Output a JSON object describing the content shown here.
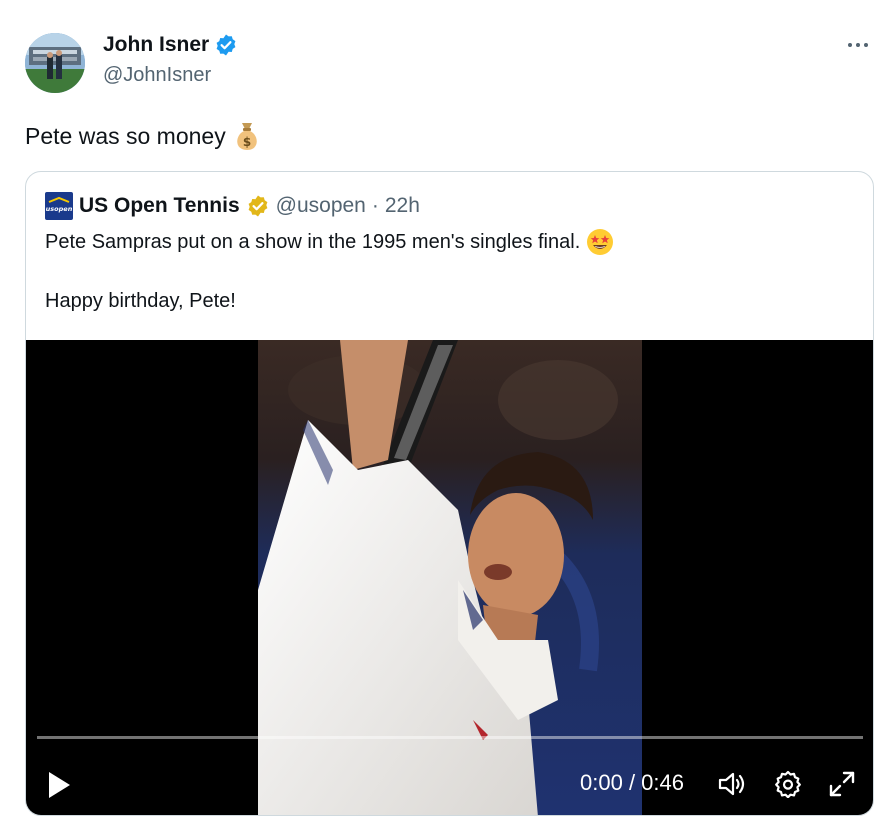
{
  "tweet": {
    "author_name": "John Isner",
    "author_handle": "@JohnIsner",
    "text": "Pete was so money",
    "emoji_icon": "money-bag-icon"
  },
  "quote": {
    "logo_text": "usopen",
    "author_name": "US Open Tennis",
    "author_handle": "@usopen",
    "separator": "·",
    "time_ago": "22h",
    "line1": "Pete Sampras put on a show in the 1995 men's singles final.",
    "line1_emoji_icon": "star-struck-icon",
    "line2": "Happy birthday, Pete!"
  },
  "video": {
    "current_time": "0:00",
    "time_separator": " / ",
    "duration": "0:46",
    "progress": 0,
    "controls": [
      "play-icon",
      "volume-icon",
      "settings-gear-icon",
      "fullscreen-icon"
    ]
  },
  "colors": {
    "verified_blue": "#1d9bf0",
    "verified_gold": "#e2b719",
    "secondary_text": "#536471",
    "border": "#cfd9de"
  }
}
